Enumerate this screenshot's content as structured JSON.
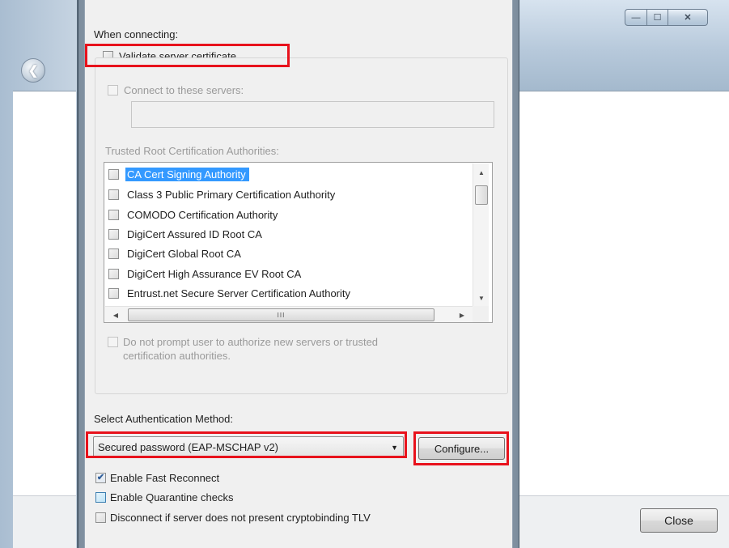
{
  "background_window": {
    "close_label": "Close",
    "caption_buttons": {
      "minimize": "—",
      "maximize": "☐",
      "close": "✕"
    }
  },
  "dialog": {
    "when_connecting": "When connecting:",
    "validate_cert": {
      "label": "Validate server certificate",
      "checked": false
    },
    "connect_servers": {
      "label": "Connect to these servers:",
      "checked": false,
      "value": ""
    },
    "trusted_roots_label": "Trusted Root Certification Authorities:",
    "trusted_roots": [
      {
        "label": "CA Cert Signing Authority",
        "checked": false,
        "selected": true
      },
      {
        "label": "Class 3 Public Primary Certification Authority",
        "checked": false
      },
      {
        "label": "COMODO Certification Authority",
        "checked": false
      },
      {
        "label": "DigiCert Assured ID Root CA",
        "checked": false
      },
      {
        "label": "DigiCert Global Root CA",
        "checked": false
      },
      {
        "label": "DigiCert High Assurance EV Root CA",
        "checked": false
      },
      {
        "label": "Entrust.net Secure Server Certification Authority",
        "checked": false
      }
    ],
    "scroll_glyphs": {
      "up": "▲",
      "down": "▼",
      "left": "◀",
      "right": "▶",
      "grip": "III"
    },
    "no_prompt": {
      "line1": "Do not prompt user to authorize new servers or trusted",
      "line2": "certification authorities.",
      "checked": false
    },
    "auth_method_label": "Select Authentication Method:",
    "auth_method_value": "Secured password (EAP-MSCHAP v2)",
    "configure_label": "Configure...",
    "fast_reconnect": {
      "label": "Enable Fast Reconnect",
      "checked": true
    },
    "quarantine": {
      "label": "Enable Quarantine checks",
      "checked": false
    },
    "cryptobinding": {
      "label": "Disconnect if server does not present cryptobinding TLV",
      "checked": false
    }
  },
  "colors": {
    "highlight_box": "#e8121c",
    "selection": "#3399ff",
    "dialog_background": "#f0f0f0"
  },
  "icons": {
    "back": "back-arrow-icon",
    "check": "checkmark-icon",
    "dropdown": "chevron-down-icon"
  }
}
